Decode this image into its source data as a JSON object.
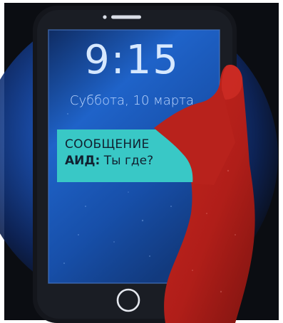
{
  "lock_screen": {
    "time": "9:15",
    "date": "Суббота, 10 марта"
  },
  "notification": {
    "title": "СООБЩЕНИЕ",
    "sender": "АИД:",
    "message": " Ты где?"
  },
  "icons": {
    "speaker": "speaker-slot-icon",
    "home": "home-button-icon"
  },
  "colors": {
    "background": "#0b0d12",
    "screen_blue": "#1f63c9",
    "notification": "#39c8c6",
    "hand_red": "#b3211c"
  }
}
